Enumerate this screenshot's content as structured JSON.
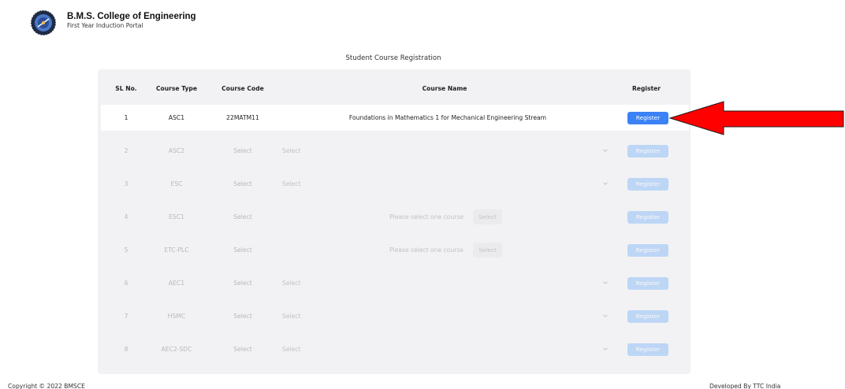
{
  "header": {
    "college_name": "B.M.S. College of Engineering",
    "portal_name": "First Year Induction Portal"
  },
  "page_title": "Student Course Registration",
  "table": {
    "columns": [
      "SL No.",
      "Course Type",
      "Course Code",
      "Course Name",
      "Register"
    ],
    "rows": [
      {
        "sl": "1",
        "type": "ASC1",
        "code": "22MATM11",
        "name": "Foundations in Mathematics 1 for Mechanical Engineering Stream",
        "button": "Register",
        "state": "active"
      },
      {
        "sl": "2",
        "type": "ASC2",
        "code": "Select",
        "name": "Select",
        "button": "Register",
        "state": "disabled"
      },
      {
        "sl": "3",
        "type": "ESC",
        "code": "Select",
        "name": "Select",
        "button": "Register",
        "state": "disabled"
      },
      {
        "sl": "4",
        "type": "ESC1",
        "code": "Select",
        "hint": "Please select one course",
        "pick": "Select",
        "button": "Register",
        "state": "disabled"
      },
      {
        "sl": "5",
        "type": "ETC-PLC",
        "code": "Select",
        "hint": "Please select one course",
        "pick": "Select",
        "button": "Register",
        "state": "disabled"
      },
      {
        "sl": "6",
        "type": "AEC1",
        "code": "Select",
        "name": "Select",
        "button": "Register",
        "state": "disabled"
      },
      {
        "sl": "7",
        "type": "HSMC",
        "code": "Select",
        "name": "Select",
        "button": "Register",
        "state": "disabled"
      },
      {
        "sl": "8",
        "type": "AEC2-SDC",
        "code": "Select",
        "name": "Select",
        "button": "Register",
        "state": "disabled"
      }
    ]
  },
  "annotation": {
    "icon": "red-arrow-icon",
    "color": "#ff0000"
  },
  "footer": {
    "copyright": "Copyright © 2022 BMSCE",
    "developer": "Developed By TTC India"
  },
  "colors": {
    "accent": "#3b82f6",
    "accent_disabled": "#93c0f8",
    "card_bg": "#f2f2f4"
  }
}
